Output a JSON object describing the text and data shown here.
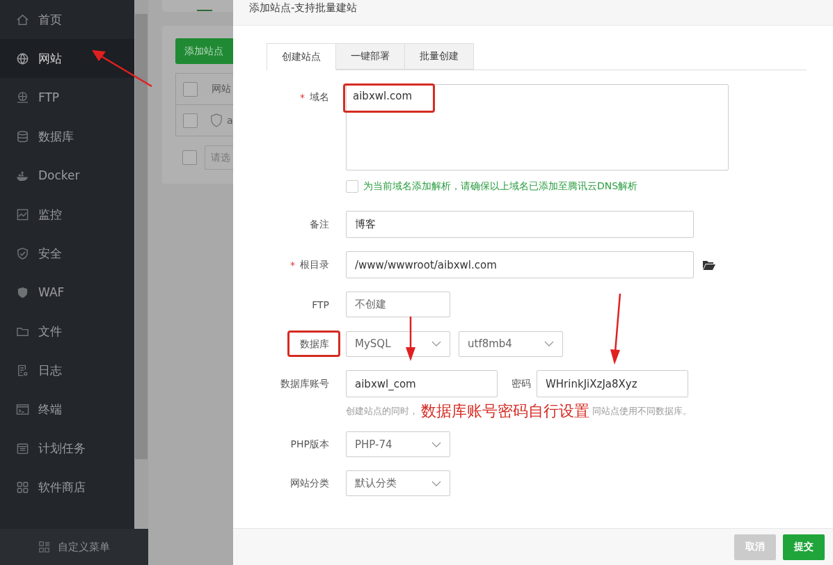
{
  "sidebar": {
    "items": [
      {
        "label": "首页",
        "selected": false
      },
      {
        "label": "网站",
        "selected": true
      },
      {
        "label": "FTP",
        "selected": false
      },
      {
        "label": "数据库",
        "selected": false
      },
      {
        "label": "Docker",
        "selected": false
      },
      {
        "label": "监控",
        "selected": false
      },
      {
        "label": "安全",
        "selected": false
      },
      {
        "label": "WAF",
        "selected": false
      },
      {
        "label": "文件",
        "selected": false
      },
      {
        "label": "日志",
        "selected": false
      },
      {
        "label": "终端",
        "selected": false
      },
      {
        "label": "计划任务",
        "selected": false
      },
      {
        "label": "软件商店",
        "selected": false
      }
    ],
    "footer": "自定义菜单"
  },
  "background": {
    "add_button": "添加站点",
    "table_rows": [
      {
        "text": "网站",
        "checked": false
      },
      {
        "text": "a",
        "checked": false
      }
    ],
    "batch": {
      "checked": false,
      "placeholder": "请选"
    }
  },
  "dialog": {
    "title": "添加站点-支持批量建站",
    "tabs": [
      {
        "label": "创建站点",
        "selected": true
      },
      {
        "label": "一键部署",
        "selected": false
      },
      {
        "label": "批量创建",
        "selected": false
      }
    ],
    "domain": {
      "label": "域名",
      "required_mark": "*",
      "value": "aibxwl.com"
    },
    "dns": {
      "label": "为当前域名添加解析，请确保以上域名已添加至腾讯云DNS解析",
      "checked": false
    },
    "remark": {
      "label": "备注",
      "value": "博客"
    },
    "root": {
      "label": "根目录",
      "required_mark": "*",
      "value": "/www/wwwroot/aibxwl.com"
    },
    "ftp": {
      "label": "FTP",
      "value": "不创建"
    },
    "database": {
      "label": "数据库",
      "type": "MySQL",
      "charset": "utf8mb4"
    },
    "account": {
      "label": "数据库账号",
      "value": "aibxwl_com",
      "password_label": "密码",
      "password": "WHrinkJiXzJa8Xyz"
    },
    "hint": {
      "start": "创建站点的同时，",
      "end": "同站点使用不同数据库。"
    },
    "php": {
      "label": "PHP版本",
      "value": "PHP-74"
    },
    "category": {
      "label": "网站分类",
      "value": "默认分类"
    },
    "cancel": "取消",
    "submit": "提交"
  },
  "annotation": "数据库账号密码自行设置"
}
